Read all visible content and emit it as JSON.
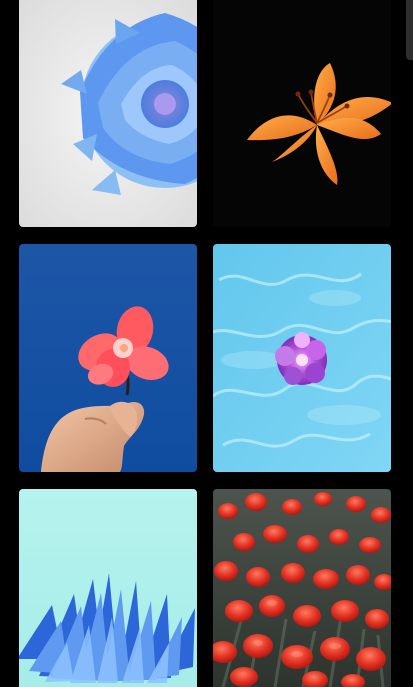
{
  "gallery": {
    "images": [
      {
        "subject": "blue-dahlia-on-light-gray-background"
      },
      {
        "subject": "orange-lily-on-black-background"
      },
      {
        "subject": "hand-holding-red-flower-against-blue-sky"
      },
      {
        "subject": "purple-flower-floating-on-water"
      },
      {
        "subject": "blue-chrysanthemum-petals-on-mint-background"
      },
      {
        "subject": "red-tulips-field"
      }
    ],
    "accent_colors": {
      "background": "#000000",
      "scrollbar": "#2e2e2e"
    }
  }
}
